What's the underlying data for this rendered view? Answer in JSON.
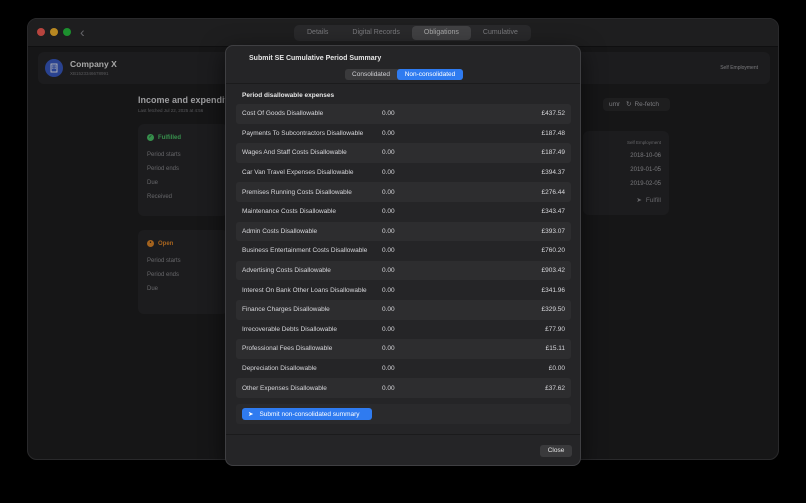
{
  "titlebar": {
    "tabs": [
      {
        "label": "Details"
      },
      {
        "label": "Digital Records"
      },
      {
        "label": "Obligations"
      },
      {
        "label": "Cumulative"
      }
    ]
  },
  "company": {
    "name": "Company X",
    "id": "XB1523346678991",
    "type": "Self Employment"
  },
  "section": {
    "title": "Income and expendit",
    "subtitle": "Last fetched Jul 22, 2025 at 4:56"
  },
  "obligations": [
    {
      "status": "Fulfilled",
      "labels": [
        "Period starts",
        "Period ends",
        "Due",
        "Received"
      ]
    },
    {
      "status": "Open",
      "labels": [
        "Period starts",
        "Period ends",
        "Due"
      ]
    }
  ],
  "right": {
    "summary_label": "ummary",
    "refetch_label": "Re-fetch",
    "card_header": "Self Employment",
    "dates": [
      "2018-10-06",
      "2019-01-05",
      "2019-02-05"
    ],
    "fulfill_label": "Fulfill"
  },
  "modal": {
    "title": "Submit SE Cumulative Period Summary",
    "tabs": [
      "Consolidated",
      "Non-consolidated"
    ],
    "section_header": "Period disallowable expenses",
    "rows": [
      {
        "name": "Cost Of Goods Disallowable",
        "value": "0.00",
        "amount": "£437.52"
      },
      {
        "name": "Payments To Subcontractors Disallowable",
        "value": "0.00",
        "amount": "£187.48"
      },
      {
        "name": "Wages And Staff Costs Disallowable",
        "value": "0.00",
        "amount": "£187.49"
      },
      {
        "name": "Car Van Travel Expenses Disallowable",
        "value": "0.00",
        "amount": "£394.37"
      },
      {
        "name": "Premises Running Costs Disallowable",
        "value": "0.00",
        "amount": "£276.44"
      },
      {
        "name": "Maintenance Costs Disallowable",
        "value": "0.00",
        "amount": "£343.47"
      },
      {
        "name": "Admin Costs Disallowable",
        "value": "0.00",
        "amount": "£393.07"
      },
      {
        "name": "Business Entertainment Costs Disallowable",
        "value": "0.00",
        "amount": "£760.20"
      },
      {
        "name": "Advertising Costs Disallowable",
        "value": "0.00",
        "amount": "£903.42"
      },
      {
        "name": "Interest On Bank Other Loans Disallowable",
        "value": "0.00",
        "amount": "£341.96"
      },
      {
        "name": "Finance Charges Disallowable",
        "value": "0.00",
        "amount": "£329.50"
      },
      {
        "name": "Irrecoverable Debts Disallowable",
        "value": "0.00",
        "amount": "£77.90"
      },
      {
        "name": "Professional Fees Disallowable",
        "value": "0.00",
        "amount": "£15.11"
      },
      {
        "name": "Depreciation Disallowable",
        "value": "0.00",
        "amount": "£0.00"
      },
      {
        "name": "Other Expenses Disallowable",
        "value": "0.00",
        "amount": "£37.62"
      }
    ],
    "submit_label": "Submit non-consolidated summary",
    "close_label": "Close"
  },
  "colors": {
    "accent": "#2f7bf0",
    "fulfilled": "#4cc76a",
    "open": "#e4892a"
  }
}
